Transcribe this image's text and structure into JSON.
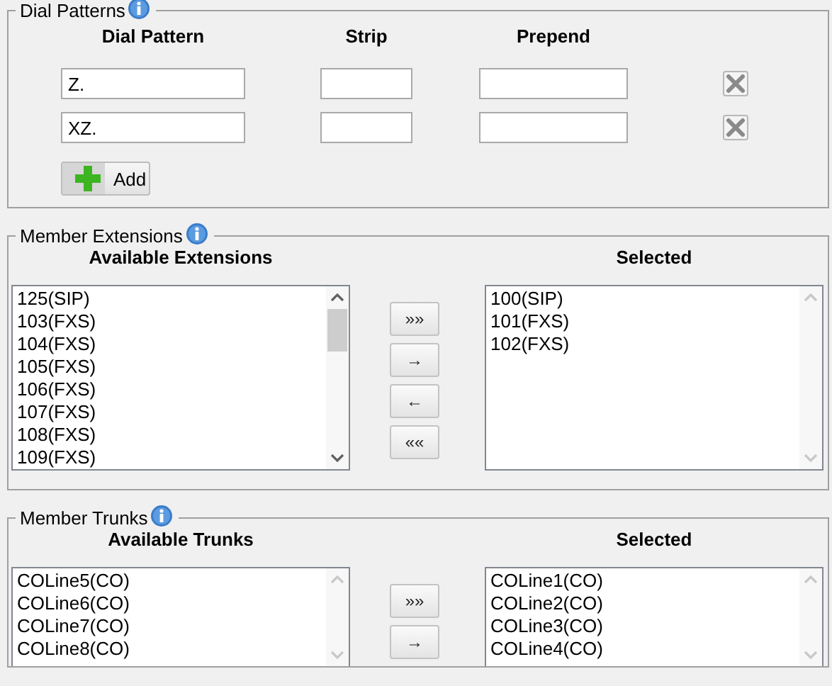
{
  "sections": [
    {
      "kind": "patterns",
      "legend": "Dial Patterns",
      "columns": [
        "Dial Pattern",
        "Strip",
        "Prepend"
      ],
      "rows": [
        {
          "dial_pattern": "Z.",
          "strip": "",
          "prepend": ""
        },
        {
          "dial_pattern": "XZ.",
          "strip": "",
          "prepend": ""
        }
      ],
      "add_button": "Add"
    },
    {
      "kind": "transfer",
      "legend": "Member Extensions",
      "available_title": "Available Extensions",
      "selected_title": "Selected",
      "available": [
        "125(SIP)",
        "103(FXS)",
        "104(FXS)",
        "105(FXS)",
        "106(FXS)",
        "107(FXS)",
        "108(FXS)",
        "109(FXS)"
      ],
      "selected": [
        "100(SIP)",
        "101(FXS)",
        "102(FXS)"
      ],
      "buttons": [
        "»»",
        "→",
        "←",
        "««"
      ]
    },
    {
      "kind": "transfer",
      "legend": "Member Trunks",
      "available_title": "Available Trunks",
      "selected_title": "Selected",
      "available": [
        "COLine5(CO)",
        "COLine6(CO)",
        "COLine7(CO)",
        "COLine8(CO)"
      ],
      "selected": [
        "COLine1(CO)",
        "COLine2(CO)",
        "COLine3(CO)",
        "COLine4(CO)"
      ],
      "buttons": [
        "»»",
        "→"
      ]
    }
  ]
}
